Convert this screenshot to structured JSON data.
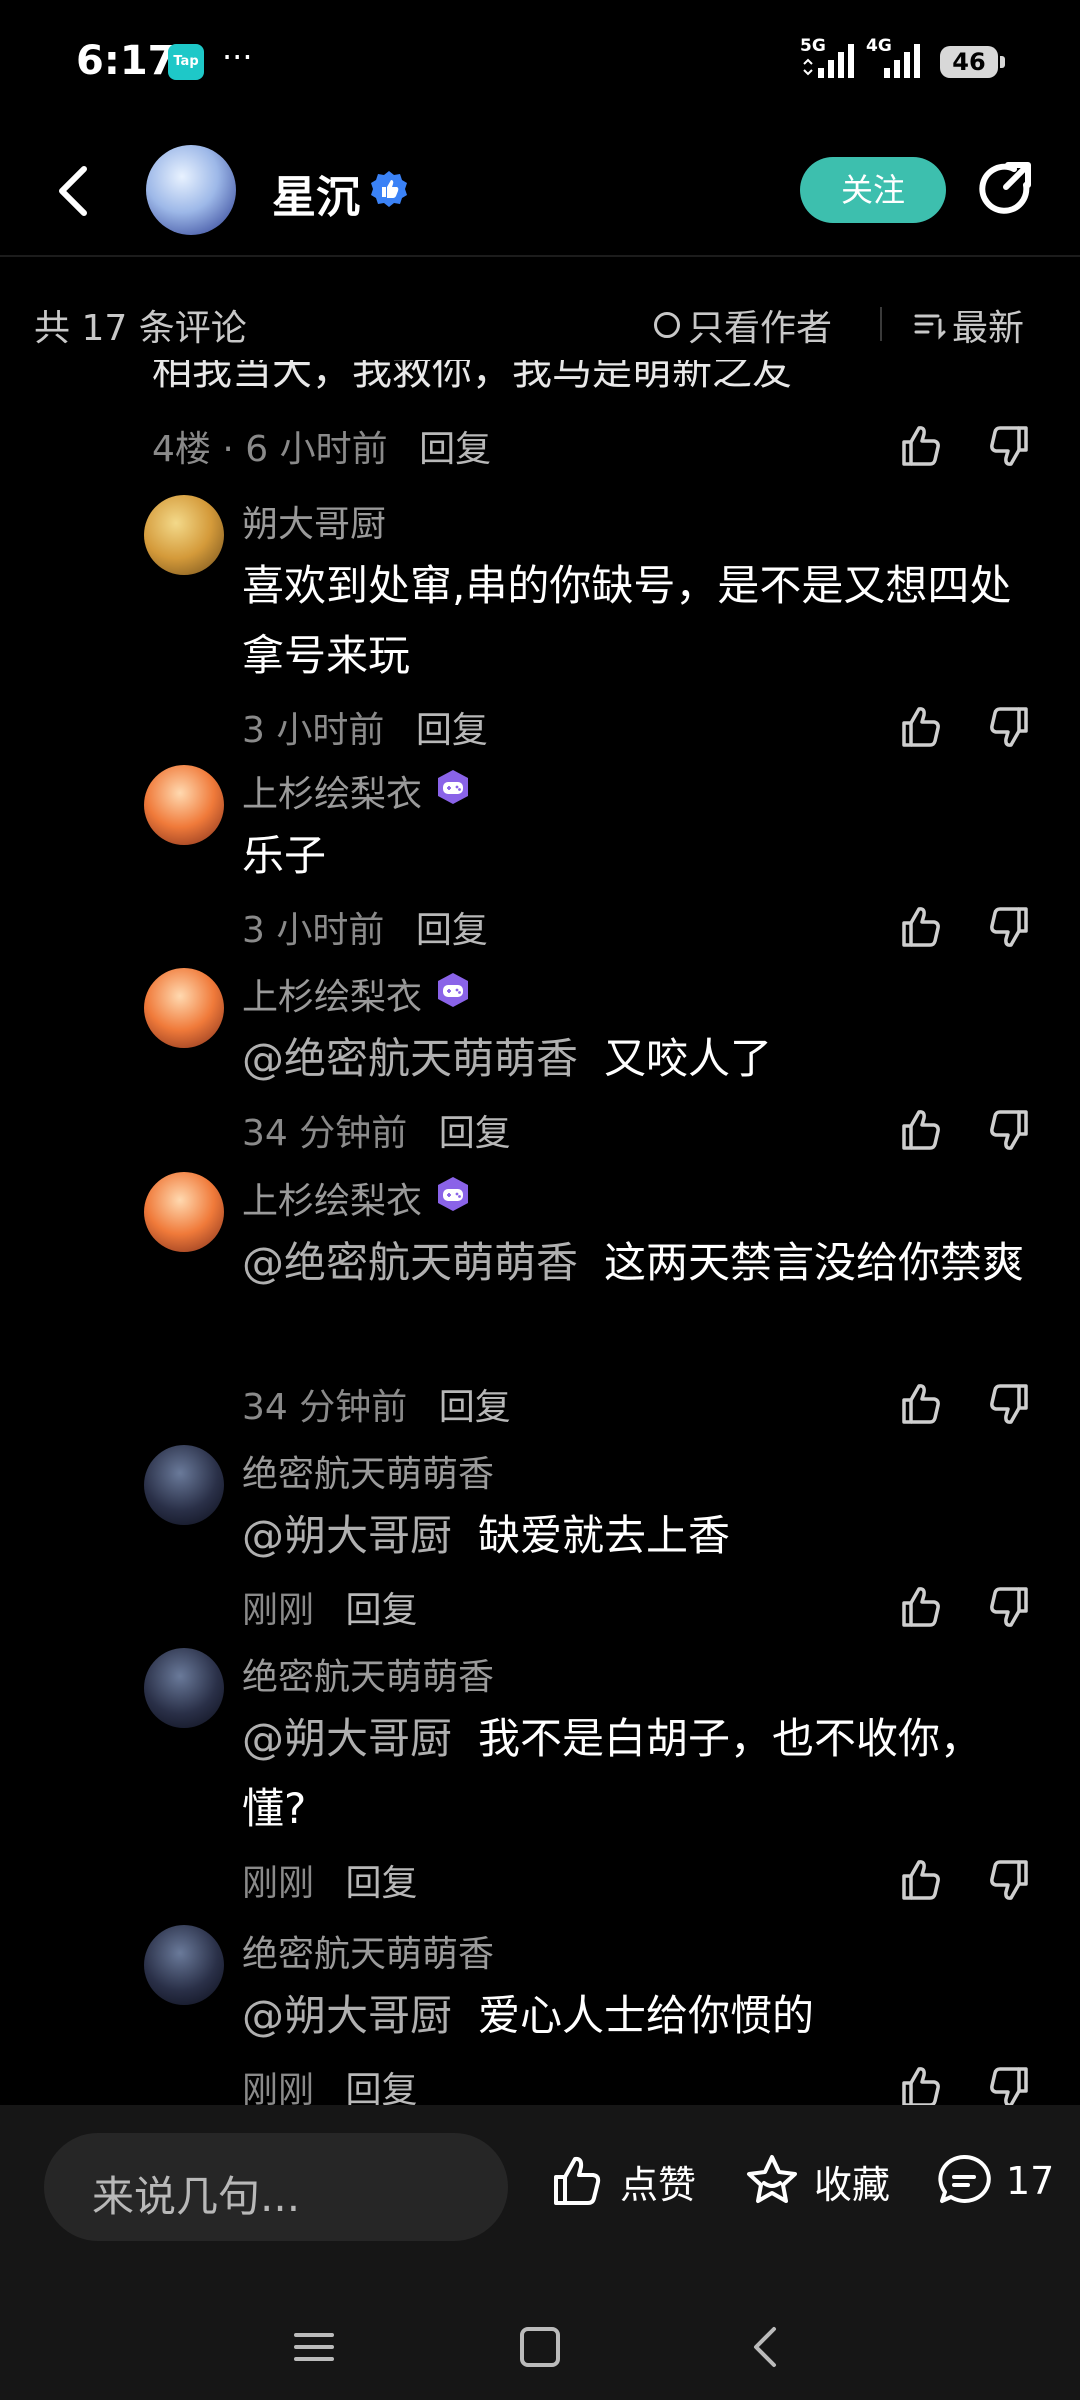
{
  "status": {
    "time": "6:17",
    "tap_badge": "Tap",
    "dots": "···",
    "sig1": "5G",
    "sig2": "4G",
    "battery": "46"
  },
  "header": {
    "username": "星沉",
    "follow_label": "关注"
  },
  "sortbar": {
    "count_label": "共 17 条评论",
    "author_only_label": "只看作者",
    "newest_label": "最新"
  },
  "cut_comment": {
    "text": "相我当大，我救你，我马是萌新之友",
    "floor": "4楼",
    "time": "6 小时前",
    "reply": "回复"
  },
  "comments": [
    {
      "name": "朔大哥厨",
      "mention": "",
      "text": "喜欢到处窜,串的你缺号，是不是又想四处拿号来玩",
      "time": "3 小时前",
      "reply": "回复",
      "badge": false
    },
    {
      "name": "上杉绘梨衣",
      "mention": "",
      "text": "乐子",
      "time": "3 小时前",
      "reply": "回复",
      "badge": true
    },
    {
      "name": "上杉绘梨衣",
      "mention": "@绝密航天萌萌香",
      "text": "又咬人了",
      "time": "34 分钟前",
      "reply": "回复",
      "badge": true
    },
    {
      "name": "上杉绘梨衣",
      "mention": "@绝密航天萌萌香",
      "text": "这两天禁言没给你禁爽",
      "time": "34 分钟前",
      "reply": "回复",
      "badge": true
    },
    {
      "name": "绝密航天萌萌香",
      "mention": "@朔大哥厨",
      "text": "缺爱就去上香",
      "time": "刚刚",
      "reply": "回复",
      "badge": false
    },
    {
      "name": "绝密航天萌萌香",
      "mention": "@朔大哥厨",
      "text": "我不是白胡子，也不收你，懂?",
      "time": "刚刚",
      "reply": "回复",
      "badge": false
    },
    {
      "name": "绝密航天萌萌香",
      "mention": "@朔大哥厨",
      "text": "爱心人士给你惯的",
      "time": "刚刚",
      "reply": "回复",
      "badge": false
    }
  ],
  "bottombar": {
    "placeholder": "来说几句...",
    "like_label": "点赞",
    "collect_label": "收藏",
    "comment_count": "17"
  },
  "colors": {
    "accent": "#3dbfae",
    "badge_purple": "#8a63e8",
    "verified_blue": "#3b82f6"
  }
}
